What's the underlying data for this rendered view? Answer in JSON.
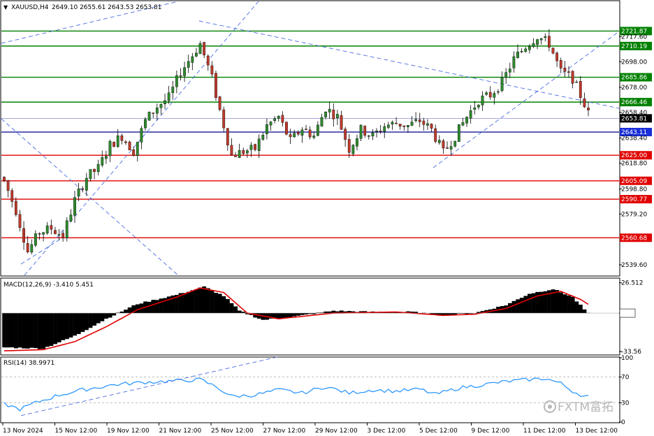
{
  "header": {
    "symbol": "XAUUSD,H4",
    "ohlc": "2649.10 2655.61 2643.53 2653.81",
    "macd_label": "MACD(12,26,9) -3.410 5.451",
    "rsi_label": "RSI(14) 38.9971",
    "watermark": "FXTM富拓"
  },
  "colors": {
    "bull": "#2e8b2e",
    "bear": "#c0392b",
    "wick": "#000000",
    "support": "#e00000",
    "resistance": "#008000",
    "current_line": "#00008b",
    "trend": "#4a6ce0",
    "rsi_line": "#1e90ff",
    "signal": "#e00000"
  },
  "chart_data": [
    {
      "type": "candlestick",
      "title": "XAUUSD,H4",
      "y_ticks": [
        2717.6,
        2698.0,
        2678.0,
        2658.4,
        2638.4,
        2618.8,
        2598.8,
        2579.2,
        2539.6
      ],
      "ylim": [
        2531.4,
        2745.0
      ],
      "x_ticks": [
        "13 Nov 2024",
        "15 Nov 12:00",
        "19 Nov 12:00",
        "21 Nov 12:00",
        "25 Nov 12:00",
        "27 Nov 12:00",
        "29 Nov 12:00",
        "3 Dec 12:00",
        "5 Dec 12:00",
        "9 Dec 12:00",
        "11 Dec 12:00",
        "13 Dec 12:00"
      ],
      "levels": [
        {
          "value": 2721.87,
          "label": "2721.87",
          "kind": "resistance"
        },
        {
          "value": 2710.19,
          "label": "2710.19",
          "kind": "resistance"
        },
        {
          "value": 2685.86,
          "label": "2685.86",
          "kind": "resistance"
        },
        {
          "value": 2666.46,
          "label": "2666.46",
          "kind": "resistance"
        },
        {
          "value": 2653.81,
          "label": "2653.81",
          "kind": "current"
        },
        {
          "value": 2643.11,
          "label": "2643.11",
          "kind": "marker"
        },
        {
          "value": 2625.0,
          "label": "2625.00",
          "kind": "support"
        },
        {
          "value": 2605.09,
          "label": "2605.09",
          "kind": "support"
        },
        {
          "value": 2590.77,
          "label": "2590.77",
          "kind": "support"
        },
        {
          "value": 2560.68,
          "label": "2560.68",
          "kind": "support"
        }
      ],
      "close_path": [
        [
          0,
          2605
        ],
        [
          3,
          2582
        ],
        [
          6,
          2550
        ],
        [
          9,
          2565
        ],
        [
          12,
          2568
        ],
        [
          15,
          2562
        ],
        [
          18,
          2590
        ],
        [
          21,
          2608
        ],
        [
          24,
          2615
        ],
        [
          27,
          2633
        ],
        [
          30,
          2640
        ],
        [
          33,
          2628
        ],
        [
          36,
          2652
        ],
        [
          39,
          2663
        ],
        [
          42,
          2670
        ],
        [
          45,
          2690
        ],
        [
          48,
          2703
        ],
        [
          50,
          2712
        ],
        [
          53,
          2685
        ],
        [
          55,
          2660
        ],
        [
          58,
          2625
        ],
        [
          61,
          2628
        ],
        [
          64,
          2630
        ],
        [
          67,
          2648
        ],
        [
          70,
          2655
        ],
        [
          73,
          2636
        ],
        [
          76,
          2646
        ],
        [
          79,
          2640
        ],
        [
          82,
          2662
        ],
        [
          85,
          2655
        ],
        [
          88,
          2630
        ],
        [
          91,
          2645
        ],
        [
          94,
          2640
        ],
        [
          97,
          2648
        ],
        [
          100,
          2650
        ],
        [
          103,
          2648
        ],
        [
          106,
          2652
        ],
        [
          109,
          2645
        ],
        [
          112,
          2627
        ],
        [
          115,
          2640
        ],
        [
          118,
          2655
        ],
        [
          121,
          2668
        ],
        [
          124,
          2672
        ],
        [
          127,
          2682
        ],
        [
          130,
          2700
        ],
        [
          133,
          2710
        ],
        [
          136,
          2718
        ],
        [
          139,
          2712
        ],
        [
          142,
          2690
        ],
        [
          145,
          2685
        ],
        [
          148,
          2665
        ],
        [
          150,
          2650
        ]
      ],
      "candle_count": 150
    },
    {
      "type": "bar",
      "title": "MACD(12,26,9) -3.410 5.451",
      "macd": -3.41,
      "signal": 5.451,
      "y_ticks": [
        26.512,
        0.0,
        -33.56
      ],
      "ylim": [
        -36,
        30
      ],
      "histogram_path": [
        [
          0,
          -30
        ],
        [
          10,
          -31
        ],
        [
          18,
          -20
        ],
        [
          26,
          -5
        ],
        [
          34,
          8
        ],
        [
          44,
          16
        ],
        [
          51,
          23
        ],
        [
          56,
          15
        ],
        [
          60,
          2
        ],
        [
          66,
          -6
        ],
        [
          74,
          -3
        ],
        [
          84,
          2
        ],
        [
          94,
          1
        ],
        [
          104,
          1
        ],
        [
          112,
          -2
        ],
        [
          120,
          0
        ],
        [
          128,
          7
        ],
        [
          134,
          17
        ],
        [
          140,
          21
        ],
        [
          145,
          14
        ],
        [
          150,
          -4
        ]
      ],
      "signal_path": [
        [
          0,
          -33
        ],
        [
          10,
          -32
        ],
        [
          18,
          -25
        ],
        [
          26,
          -12
        ],
        [
          34,
          3
        ],
        [
          44,
          14
        ],
        [
          50,
          22
        ],
        [
          56,
          18
        ],
        [
          62,
          0
        ],
        [
          70,
          -5
        ],
        [
          84,
          0
        ],
        [
          100,
          1
        ],
        [
          112,
          -2
        ],
        [
          120,
          -1
        ],
        [
          128,
          4
        ],
        [
          136,
          15
        ],
        [
          142,
          19
        ],
        [
          147,
          12
        ],
        [
          150,
          5.45
        ]
      ]
    },
    {
      "type": "line",
      "title": "RSI(14) 38.9971",
      "rsi": 38.9971,
      "y_ticks": [
        100,
        70,
        30,
        0
      ],
      "ylim": [
        0,
        100
      ],
      "rsi_path": [
        [
          0,
          28
        ],
        [
          4,
          20
        ],
        [
          8,
          30
        ],
        [
          14,
          42
        ],
        [
          20,
          50
        ],
        [
          28,
          58
        ],
        [
          36,
          62
        ],
        [
          44,
          64
        ],
        [
          50,
          66
        ],
        [
          54,
          55
        ],
        [
          58,
          40
        ],
        [
          64,
          42
        ],
        [
          70,
          50
        ],
        [
          76,
          45
        ],
        [
          82,
          55
        ],
        [
          88,
          45
        ],
        [
          94,
          50
        ],
        [
          100,
          48
        ],
        [
          106,
          51
        ],
        [
          110,
          43
        ],
        [
          116,
          53
        ],
        [
          122,
          58
        ],
        [
          128,
          63
        ],
        [
          134,
          66
        ],
        [
          138,
          68
        ],
        [
          142,
          60
        ],
        [
          145,
          48
        ],
        [
          148,
          40
        ],
        [
          150,
          39
        ]
      ]
    }
  ]
}
